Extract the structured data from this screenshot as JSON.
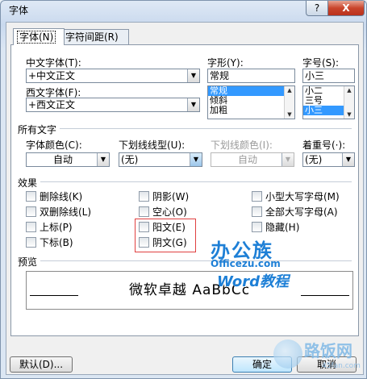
{
  "window": {
    "title": "字体",
    "help_glyph": "?",
    "close_glyph": "X"
  },
  "tabs": [
    {
      "label": "字体(N)"
    },
    {
      "label": "字符间距(R)"
    }
  ],
  "font_section": {
    "chinese_font_label": "中文字体(T):",
    "chinese_font_value": "+中文正文",
    "western_font_label": "西文字体(F):",
    "western_font_value": "+西文正文",
    "style_label": "字形(Y):",
    "style_value": "常规",
    "style_options": [
      "常规",
      "倾斜",
      "加粗"
    ],
    "size_label": "字号(S):",
    "size_value": "小三",
    "size_options": [
      "小二",
      "三号",
      "小三"
    ]
  },
  "all_text": {
    "section_label": "所有文字",
    "font_color_label": "字体颜色(C):",
    "font_color_value": "自动",
    "underline_type_label": "下划线线型(U):",
    "underline_type_value": "(无)",
    "underline_color_label": "下划线颜色(I):",
    "underline_color_value": "自动",
    "emphasis_label": "着重号(·):",
    "emphasis_value": "(无)"
  },
  "effects": {
    "section_label": "效果",
    "items": [
      {
        "label": "删除线(K)",
        "checked": false
      },
      {
        "label": "双删除线(L)",
        "checked": false
      },
      {
        "label": "上标(P)",
        "checked": false
      },
      {
        "label": "下标(B)",
        "checked": false
      },
      {
        "label": "阴影(W)",
        "checked": false
      },
      {
        "label": "空心(O)",
        "checked": false
      },
      {
        "label": "阳文(E)",
        "checked": false
      },
      {
        "label": "阴文(G)",
        "checked": false
      },
      {
        "label": "小型大写字母(M)",
        "checked": false
      },
      {
        "label": "全部大写字母(A)",
        "checked": false
      },
      {
        "label": "隐藏(H)",
        "checked": false
      }
    ]
  },
  "preview": {
    "section_label": "预览",
    "sample_text": "微软卓越 AaBbCc"
  },
  "buttons": {
    "default_label": "默认(D)...",
    "ok_label": "确定",
    "cancel_label": "取消"
  },
  "watermarks": {
    "logo_text": "办公族",
    "site_text": "Officezu.com",
    "tutorial_text": "Word教程",
    "corner_text": "路饭网",
    "corner_site": "45fan.com"
  },
  "colors": {
    "selection": "#3399ff",
    "highlight_box": "#e04040",
    "watermark": "#1d7fd6"
  }
}
